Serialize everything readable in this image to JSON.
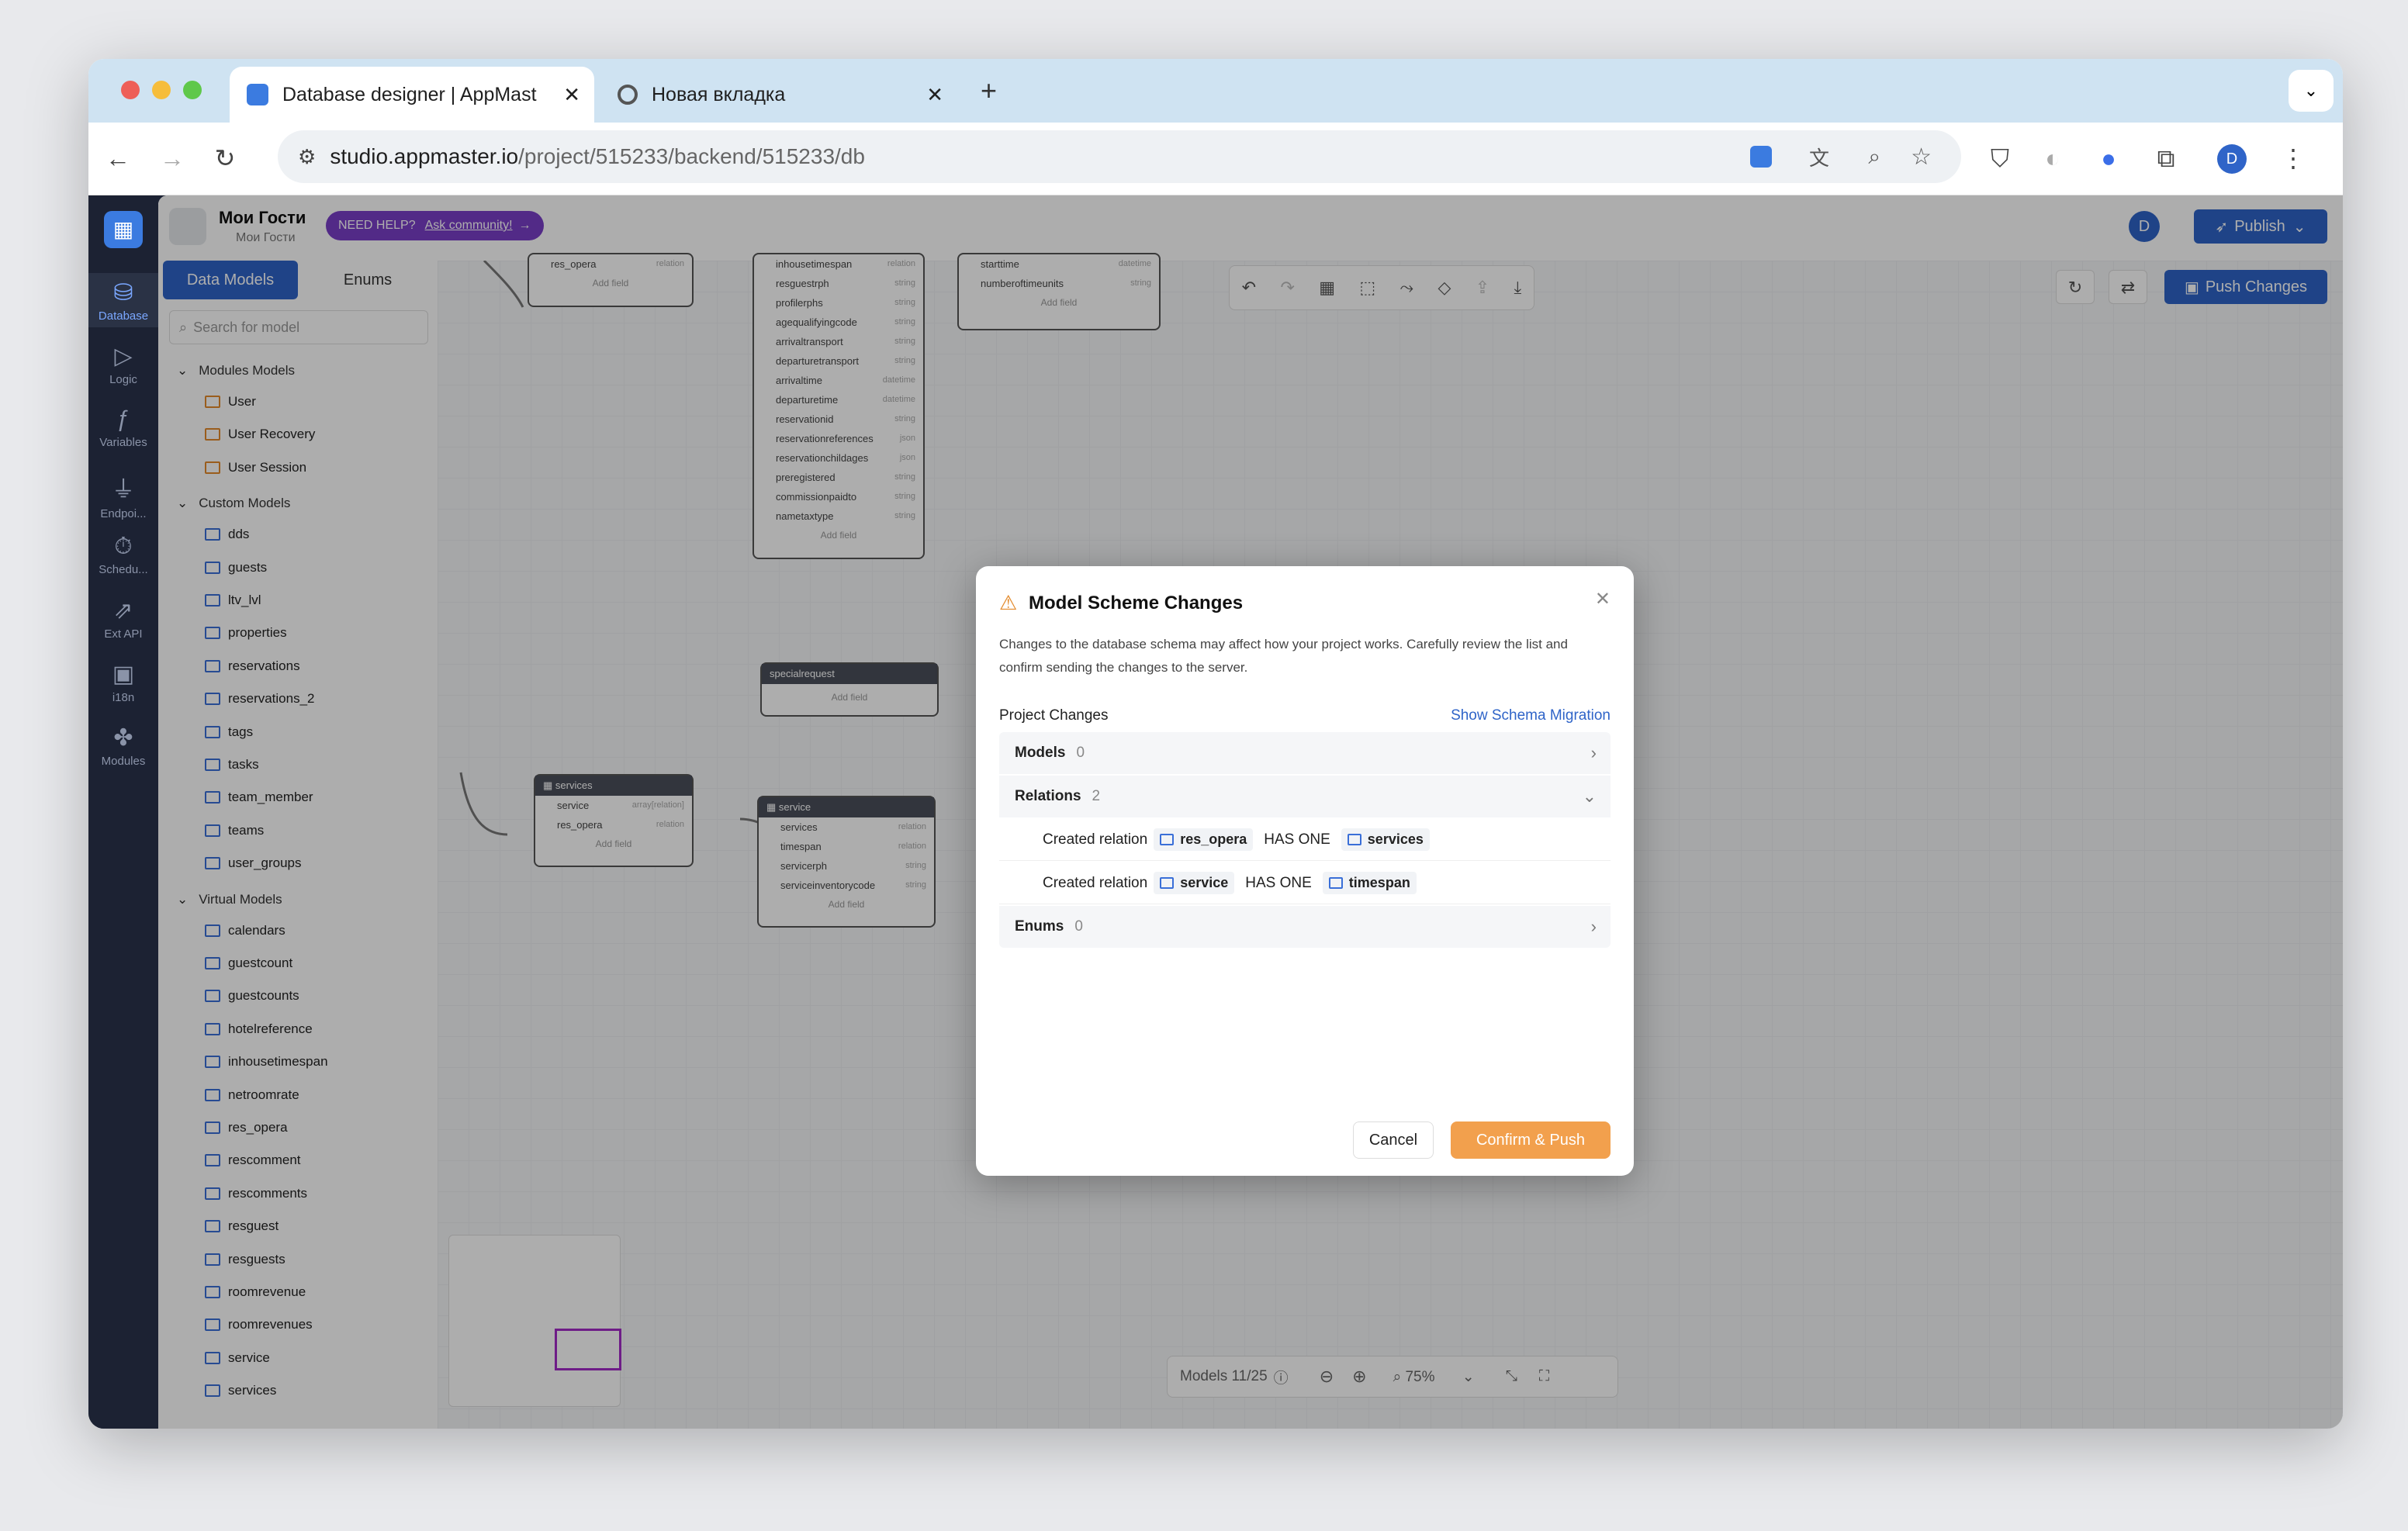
{
  "browser": {
    "tabs": [
      {
        "title": "Database designer | AppMast"
      },
      {
        "title": "Новая вкладка"
      }
    ],
    "url_host": "studio.appmaster.io",
    "url_path": "/project/515233/backend/515233/db",
    "profile_initial": "D"
  },
  "rail": [
    {
      "label": "Database"
    },
    {
      "label": "Logic"
    },
    {
      "label": "Variables"
    },
    {
      "label": "Endpoi..."
    },
    {
      "label": "Schedu..."
    },
    {
      "label": "Ext API"
    },
    {
      "label": "i18n"
    },
    {
      "label": "Modules"
    }
  ],
  "topbar": {
    "project_name": "Мои Гости",
    "project_sub": "Мои Гости",
    "help_label": "NEED HELP?",
    "help_link": "Ask community!",
    "user_initial": "D",
    "publish_label": "Publish",
    "push_label": "Push Changes"
  },
  "sidebar": {
    "tab_models": "Data Models",
    "tab_enums": "Enums",
    "search_placeholder": "Search for model",
    "groups": [
      {
        "name": "Modules Models",
        "items": [
          "User",
          "User Recovery",
          "User Session"
        ]
      },
      {
        "name": "Custom Models",
        "items": [
          "dds",
          "guests",
          "ltv_lvl",
          "properties",
          "reservations",
          "reservations_2",
          "tags",
          "tasks",
          "team_member",
          "teams",
          "user_groups"
        ]
      },
      {
        "name": "Virtual Models",
        "items": [
          "calendars",
          "guestcount",
          "guestcounts",
          "hotelreference",
          "inhousetimespan",
          "netroomrate",
          "res_opera",
          "rescomment",
          "rescomments",
          "resguest",
          "resguests",
          "roomrevenue",
          "roomrevenues",
          "service",
          "services"
        ]
      }
    ]
  },
  "canvas": {
    "add_field": "Add field",
    "node_top_left": {
      "field": "res_opera",
      "type": "relation"
    },
    "node_big": {
      "fields": [
        [
          "inhousetimespan",
          "relation"
        ],
        [
          "resguestrph",
          "string"
        ],
        [
          "profilerphs",
          "string"
        ],
        [
          "agequalifyingcode",
          "string"
        ],
        [
          "arrivaltransport",
          "string"
        ],
        [
          "departuretransport",
          "string"
        ],
        [
          "arrivaltime",
          "datetime"
        ],
        [
          "departuretime",
          "datetime"
        ],
        [
          "reservationid",
          "string"
        ],
        [
          "reservationreferences",
          "json"
        ],
        [
          "reservationchildages",
          "json"
        ],
        [
          "preregistered",
          "string"
        ],
        [
          "commissionpaidto",
          "string"
        ],
        [
          "nametaxtype",
          "string"
        ]
      ]
    },
    "node_top_right": {
      "fields": [
        [
          "starttime",
          "datetime"
        ],
        [
          "numberoftimeunits",
          "string"
        ]
      ]
    },
    "node_special": {
      "title": "specialrequest"
    },
    "node_services": {
      "title": "services",
      "fields": [
        [
          "service",
          "array[relation]"
        ],
        [
          "res_opera",
          "relation"
        ]
      ]
    },
    "node_service": {
      "title": "service",
      "fields": [
        [
          "services",
          "relation"
        ],
        [
          "timespan",
          "relation"
        ],
        [
          "servicerph",
          "string"
        ],
        [
          "serviceinventorycode",
          "string"
        ]
      ]
    },
    "bottom": {
      "models_count": "Models 11/25",
      "zoom": "75%"
    }
  },
  "modal": {
    "title": "Model Scheme Changes",
    "description": "Changes to the database schema may affect how your project works. Carefully review the list and confirm sending the changes to the server.",
    "section_label": "Project Changes",
    "show_migration": "Show Schema Migration",
    "models": {
      "label": "Models",
      "count": "0"
    },
    "relations": {
      "label": "Relations",
      "count": "2"
    },
    "relation_items": [
      {
        "prefix": "Created relation",
        "from": "res_opera",
        "kind": "HAS ONE",
        "to": "services"
      },
      {
        "prefix": "Created relation",
        "from": "service",
        "kind": "HAS ONE",
        "to": "timespan"
      }
    ],
    "enums": {
      "label": "Enums",
      "count": "0"
    },
    "cancel": "Cancel",
    "confirm": "Confirm & Push"
  }
}
